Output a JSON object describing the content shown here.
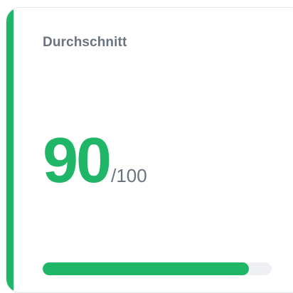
{
  "card": {
    "title": "Durchschnitt",
    "score": "90",
    "score_max": "/100",
    "progress_fraction": 0.9
  },
  "colors": {
    "accent": "#1fb767",
    "muted_text": "#6b7380",
    "track": "#eef0f3"
  }
}
